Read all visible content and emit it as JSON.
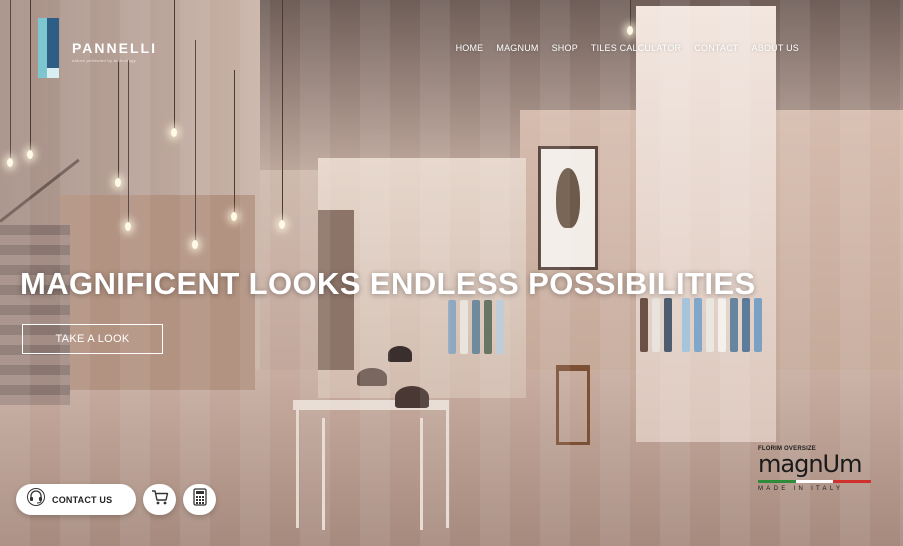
{
  "brand": {
    "name": "PANNELLI",
    "tagline": "nature perfected by technology"
  },
  "nav": {
    "items": [
      "HOME",
      "MAGNUM",
      "SHOP",
      "TILES CALCULATOR",
      "CONTACT",
      "ABOUT US"
    ]
  },
  "hero": {
    "headline": "MAGNIFICENT LOOKS ENDLESS POSSIBILITIES",
    "cta_label": "TAKE A LOOK"
  },
  "actions": {
    "contact_label": "CONTACT US"
  },
  "badge": {
    "subtitle": "FLORIM OVERSIZE",
    "brand": "magnUm",
    "origin": "MADE IN ITALY"
  },
  "colors": {
    "logo_light": "#7ec6cf",
    "logo_dark": "#2e5d86",
    "flag_green": "#2e8b3a",
    "flag_white": "#ffffff",
    "flag_red": "#d0312d"
  },
  "icons": [
    "headset-icon",
    "cart-icon",
    "calculator-icon"
  ]
}
